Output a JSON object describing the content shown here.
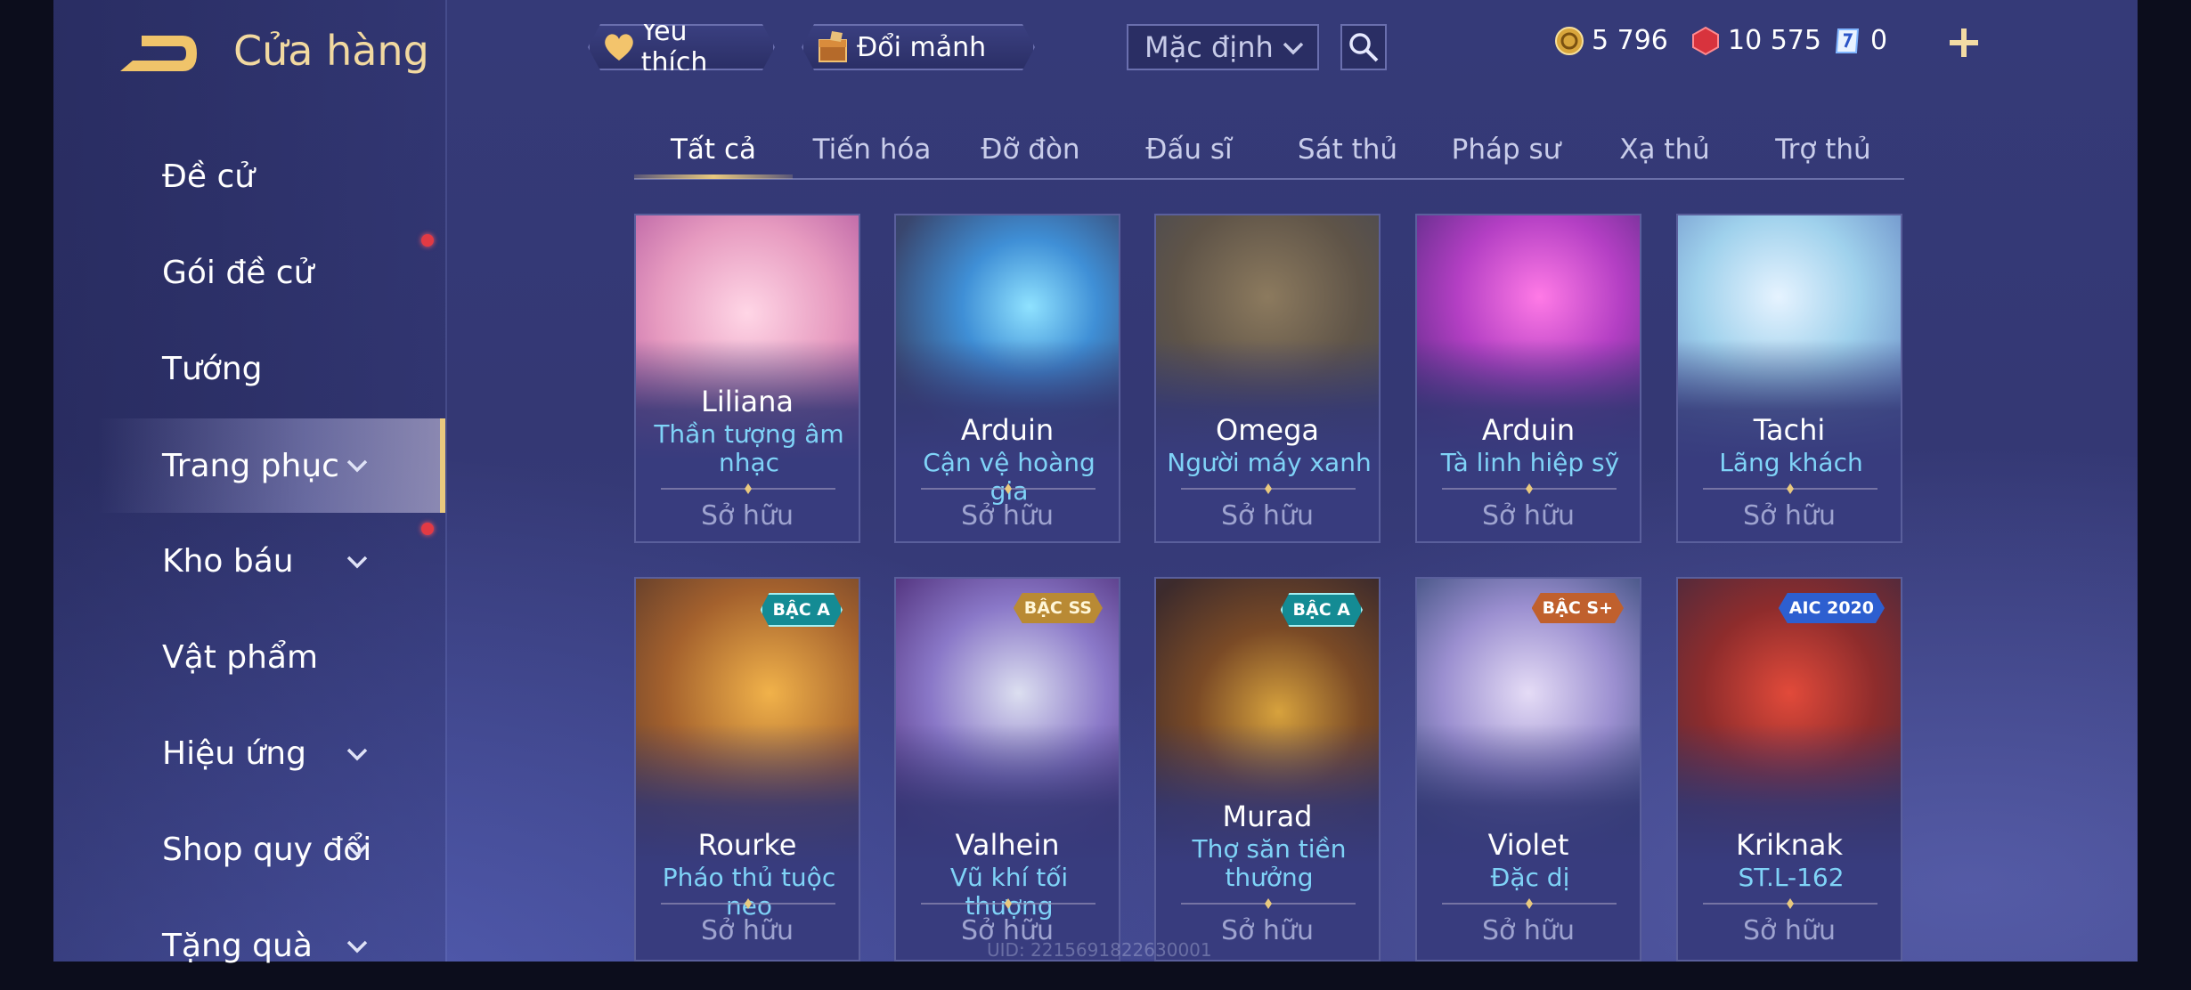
{
  "header": {
    "title": "Cửa hàng",
    "favorite_label": "Yêu thích",
    "exchange_label": "Đổi mảnh",
    "sort_value": "Mặc định"
  },
  "currencies": {
    "gold": "5 796",
    "voucher": "10 575",
    "fragment": "0"
  },
  "sidebar": {
    "items": [
      {
        "label": "Đề cử"
      },
      {
        "label": "Gói đề cử"
      },
      {
        "label": "Tướng"
      },
      {
        "label": "Trang phục"
      },
      {
        "label": "Kho báu"
      },
      {
        "label": "Vật phẩm"
      },
      {
        "label": "Hiệu ứng"
      },
      {
        "label": "Shop quy đổi"
      },
      {
        "label": "Tặng quà"
      }
    ]
  },
  "tabs": [
    "Tất cả",
    "Tiến hóa",
    "Đỡ đòn",
    "Đấu sĩ",
    "Sát thủ",
    "Pháp sư",
    "Xạ thủ",
    "Trợ thủ"
  ],
  "cards": [
    {
      "hero": "Liliana",
      "skin": "Thần tượng âm nhạc",
      "status": "Sở hữu"
    },
    {
      "hero": "Arduin",
      "skin": "Cận vệ hoàng gia",
      "status": "Sở hữu"
    },
    {
      "hero": "Omega",
      "skin": "Người máy xanh",
      "status": "Sở hữu"
    },
    {
      "hero": "Arduin",
      "skin": "Tà linh hiệp sỹ",
      "status": "Sở hữu"
    },
    {
      "hero": "Tachi",
      "skin": "Lãng khách",
      "status": "Sở hữu"
    },
    {
      "hero": "Rourke",
      "skin": "Pháo thủ tuộc neo",
      "status": "Sở hữu",
      "tier": "BẬC A"
    },
    {
      "hero": "Valhein",
      "skin": "Vũ khí tối thượng",
      "status": "Sở hữu",
      "tier": "BẬC SS"
    },
    {
      "hero": "Murad",
      "skin": "Thợ săn tiền thưởng",
      "status": "Sở hữu",
      "tier": "BẬC A"
    },
    {
      "hero": "Violet",
      "skin": "Đặc dị",
      "status": "Sở hữu",
      "tier": "BẬC S+"
    },
    {
      "hero": "Kriknak",
      "skin": "ST.L-162",
      "status": "Sở hữu",
      "tier": "AIC 2020"
    }
  ],
  "uid": "UID: 2215691822630001",
  "colors": {
    "gold_accent": "#e9c97e",
    "skin_name": "#7fd3f7",
    "notification_dot": "#e23a44",
    "background": "#353a78"
  },
  "icons": [
    "back-arrow-icon",
    "heart-icon",
    "fragment-chest-icon",
    "chevron-down-icon",
    "search-icon",
    "gold-coin-icon",
    "voucher-gem-icon",
    "fragment-card-icon",
    "plus-icon"
  ]
}
